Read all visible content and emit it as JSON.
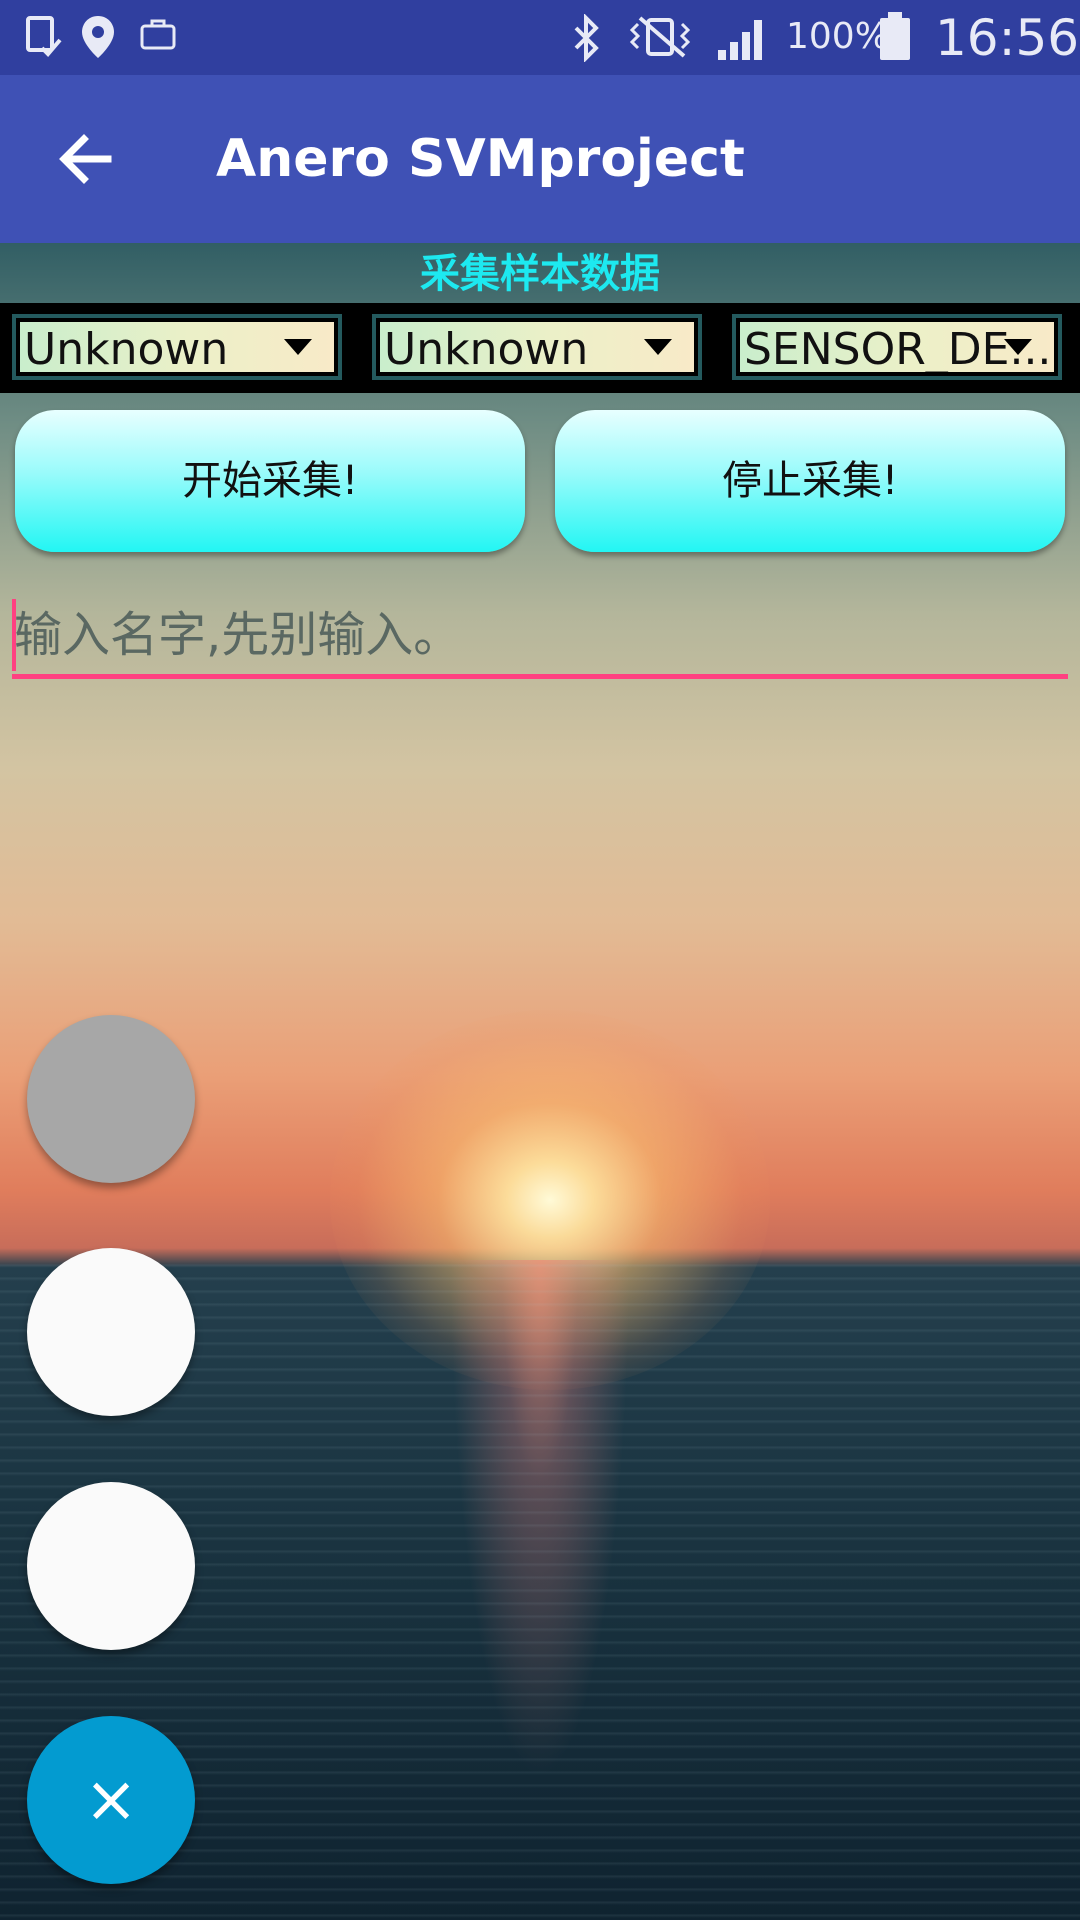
{
  "status_bar": {
    "icons": [
      "screenshot-icon",
      "location-icon",
      "briefcase-icon",
      "bluetooth-icon",
      "vibrate-icon",
      "signal-icon",
      "battery-icon"
    ],
    "battery": "100%",
    "time": "16:56"
  },
  "app_bar": {
    "title": "Anero SVMproject",
    "back_icon": "arrow-back-icon"
  },
  "section": {
    "title": "采集样本数据"
  },
  "spinners": [
    {
      "value": "Unknown"
    },
    {
      "value": "Unknown"
    },
    {
      "value": "SENSOR_DE..."
    }
  ],
  "buttons": {
    "start": "开始采集!",
    "stop": "停止采集!"
  },
  "name_input": {
    "value": "",
    "placeholder": "输入名字,先别输入。"
  },
  "fabs": {
    "close_symbol": "×",
    "colors": {
      "gray": "#a7a7a7",
      "white": "#fafafa",
      "close": "#039bd0"
    }
  },
  "colors": {
    "status_bar": "#303f9f",
    "app_bar": "#3f51b5",
    "section_title": "#1de9f0",
    "accent": "#ff4081"
  }
}
